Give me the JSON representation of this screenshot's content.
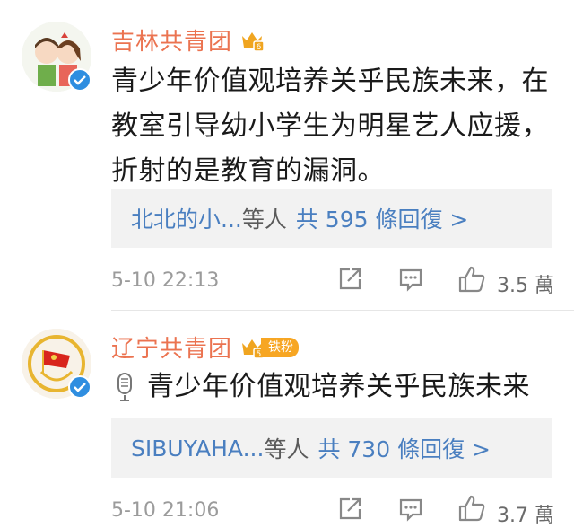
{
  "comments": [
    {
      "username": "吉林共青团",
      "content": "青少年价值观培养关乎民族未来，在教室引导幼小学生为明星艺人应援，折射的是教育的漏洞。",
      "replies": {
        "names": "北北的小...",
        "suffix": "等人",
        "count_text": "共 595 條回復 >"
      },
      "timestamp": "5-10 22:13",
      "likes": "3.5 萬",
      "crown_level": "6"
    },
    {
      "username": "辽宁共青团",
      "fan_badge": "铁粉",
      "voice_icon": "microphone-icon",
      "content": "青少年价值观培养关乎民族未来",
      "replies": {
        "names": "SIBUYAHA...",
        "suffix": "等人",
        "count_text": "共 730 條回復 >"
      },
      "timestamp": "5-10 21:06",
      "likes": "3.7 萬",
      "crown_level": "5"
    }
  ],
  "colors": {
    "username": "#eb7350",
    "link": "#4a7fc0",
    "verified": "#2f8ee0",
    "badge": "#f7a623"
  }
}
